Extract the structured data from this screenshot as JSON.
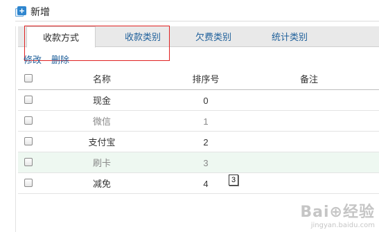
{
  "toolbar": {
    "add_label": "新增"
  },
  "tabs": [
    {
      "label": "收款方式"
    },
    {
      "label": "收款类别"
    },
    {
      "label": "欠费类别"
    },
    {
      "label": "统计类别"
    }
  ],
  "actions": {
    "edit": "修改",
    "delete": "删除"
  },
  "table": {
    "headers": {
      "name": "名称",
      "sort": "排序号",
      "note": "备注"
    },
    "rows": [
      {
        "name": "现金",
        "sort": "0",
        "note": ""
      },
      {
        "name": "微信",
        "sort": "1",
        "note": ""
      },
      {
        "name": "支付宝",
        "sort": "2",
        "note": ""
      },
      {
        "name": "刷卡",
        "sort": "3",
        "note": ""
      },
      {
        "name": "减免",
        "sort": "4",
        "note": ""
      }
    ]
  },
  "callout": "3",
  "watermark": {
    "main": "Bai⊕经验",
    "sub": "jingyan.baidu.com"
  },
  "colors": {
    "accent": "#2f86cf",
    "link": "#1e5f9a",
    "highlight_box": "#e02020",
    "row_highlight": "#eef8f1"
  }
}
